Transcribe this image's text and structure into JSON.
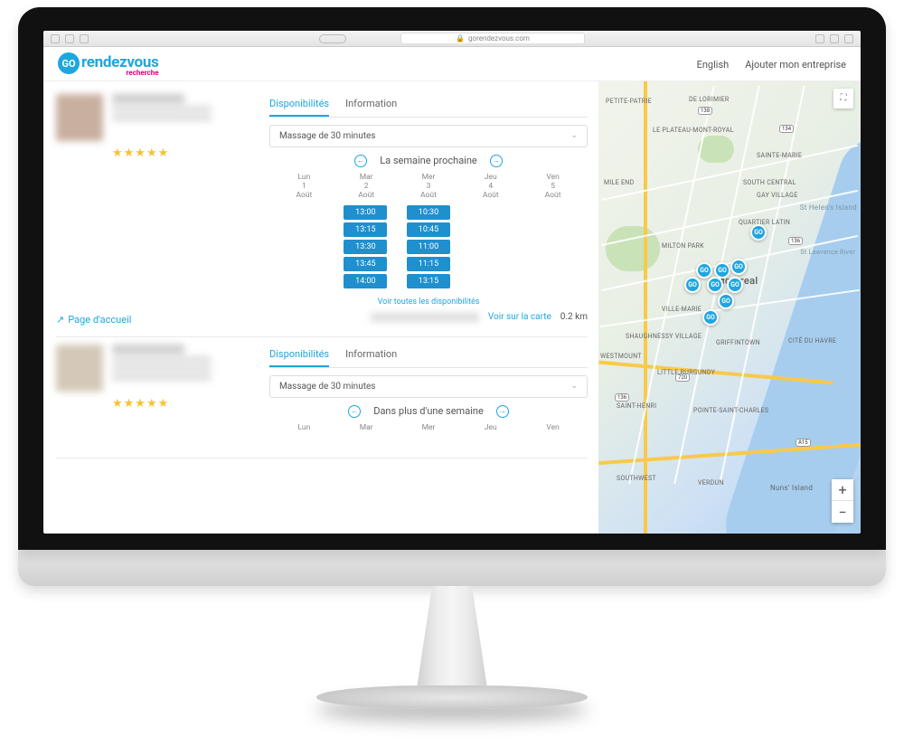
{
  "browser": {
    "url": "gorendezvous.com"
  },
  "header": {
    "logo_go": "GO",
    "logo_text": "rendezvous",
    "logo_sub": "recherche",
    "lang": "English",
    "add_biz": "Ajouter mon entreprise"
  },
  "listing": {
    "home_link": "Page d'accueil",
    "tabs": {
      "avail": "Disponibilités",
      "info": "Information"
    },
    "see_all": "Voir toutes les disponibilités",
    "map_link": "Voir sur la carte"
  },
  "results": [
    {
      "service": "Massage de 30 minutes",
      "week_label": "La semaine prochaine",
      "days": [
        {
          "dow": "Lun",
          "num": "1",
          "mon": "Août"
        },
        {
          "dow": "Mar",
          "num": "2",
          "mon": "Août"
        },
        {
          "dow": "Mer",
          "num": "3",
          "mon": "Août"
        },
        {
          "dow": "Jeu",
          "num": "4",
          "mon": "Août"
        },
        {
          "dow": "Ven",
          "num": "5",
          "mon": "Août"
        }
      ],
      "slots": [
        [],
        [
          "13:00",
          "13:15",
          "13:30",
          "13:45",
          "14:00"
        ],
        [
          "10:30",
          "10:45",
          "11:00",
          "11:15",
          "13:15"
        ],
        [],
        []
      ],
      "distance": "0.2 km",
      "rating": 5
    },
    {
      "service": "Massage de 30 minutes",
      "week_label": "Dans plus d'une semaine",
      "days": [
        {
          "dow": "Lun",
          "num": "",
          "mon": ""
        },
        {
          "dow": "Mar",
          "num": "",
          "mon": ""
        },
        {
          "dow": "Mer",
          "num": "",
          "mon": ""
        },
        {
          "dow": "Jeu",
          "num": "",
          "mon": ""
        },
        {
          "dow": "Ven",
          "num": "",
          "mon": ""
        }
      ],
      "slots": [
        [],
        [],
        [],
        [],
        []
      ],
      "distance": "",
      "rating": 5
    }
  ],
  "map": {
    "city": "Montreal",
    "labels": [
      "PETITE-PATRIE",
      "DE LORIMIER",
      "LE PLATEAU-MONT-ROYAL",
      "SAINTE-MARIE",
      "MILE END",
      "SOUTH CENTRAL",
      "GAY VILLAGE",
      "QUARTIER LATIN",
      "MILTON PARK",
      "VILLE-MARIE",
      "SHAUGHNESSY VILLAGE",
      "GRIFFINTOWN",
      "CITÉ DU HAVRE",
      "WESTMOUNT",
      "LITTLE BURGUNDY",
      "SAINT-HENRI",
      "POINTE-SAINT-CHARLES",
      "VERDUN",
      "Nuns' Island",
      "SOUTHWEST",
      "St Helen's Island",
      "St Lawrence River"
    ],
    "shields": [
      "138",
      "134",
      "136",
      "136",
      "720",
      "A15"
    ]
  }
}
